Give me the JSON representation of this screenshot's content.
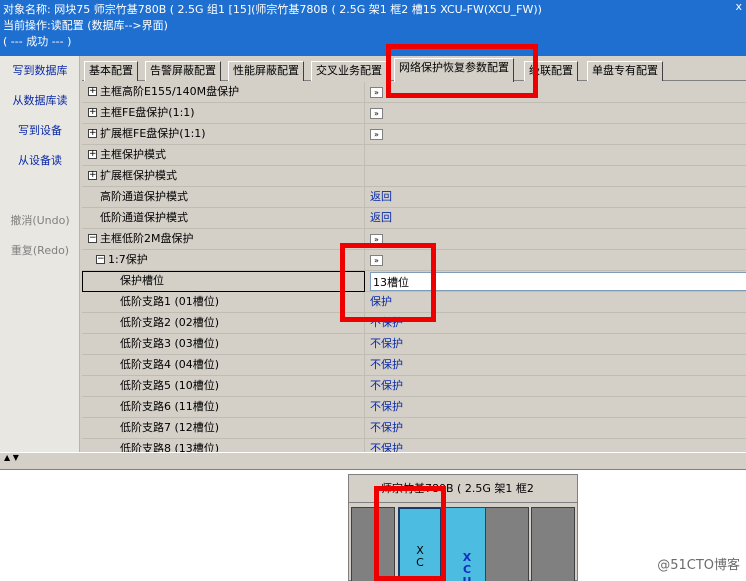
{
  "header": {
    "line1": "对象名称: 网块75 师宗竹基780B ( 2.5G 组1 [15](师宗竹基780B ( 2.5G 架1 框2 槽15 XCU-FW(XCU_FW))",
    "line2": "当前操作:读配置 (数据库-->界面)",
    "line3": "( --- 成功 --- )",
    "close": "x"
  },
  "leftnav": {
    "write_db": "写到数据库",
    "read_db": "从数据库读",
    "write_dev": "写到设备",
    "read_dev": "从设备读",
    "undo": "撤消(Undo)",
    "redo": "重复(Redo)"
  },
  "tabs": [
    "基本配置",
    "告警屏蔽配置",
    "性能屏蔽配置",
    "交叉业务配置",
    "网络保护恢复参数配置",
    "级联配置",
    "单盘专有配置"
  ],
  "rows": [
    {
      "label": "主框高阶E155/140M盘保护",
      "value": "»",
      "pm": "+"
    },
    {
      "label": "主框FE盘保护(1:1)",
      "value": "»",
      "pm": "+"
    },
    {
      "label": "扩展框FE盘保护(1:1)",
      "value": "»",
      "pm": "+"
    },
    {
      "label": "主框保护模式",
      "value": "",
      "pm": "+"
    },
    {
      "label": "扩展框保护模式",
      "value": "",
      "pm": "+"
    },
    {
      "label": "高阶通道保护模式",
      "value": "返回",
      "pm": ""
    },
    {
      "label": "低阶通道保护模式",
      "value": "返回",
      "pm": ""
    },
    {
      "label": "主框低阶2M盘保护",
      "value": "»",
      "pm": "−"
    },
    {
      "label": "1:7保护",
      "value": "»",
      "pm": "−"
    },
    {
      "label": "保护槽位",
      "value": "13槽位",
      "pm": ""
    },
    {
      "label": "低阶支路1 (01槽位)",
      "value": "保护",
      "pm": ""
    },
    {
      "label": "低阶支路2 (02槽位)",
      "value": "不保护",
      "pm": ""
    },
    {
      "label": "低阶支路3 (03槽位)",
      "value": "不保护",
      "pm": ""
    },
    {
      "label": "低阶支路4 (04槽位)",
      "value": "不保护",
      "pm": ""
    },
    {
      "label": "低阶支路5 (10槽位)",
      "value": "不保护",
      "pm": ""
    },
    {
      "label": "低阶支路6 (11槽位)",
      "value": "不保护",
      "pm": ""
    },
    {
      "label": "低阶支路7 (12槽位)",
      "value": "不保护",
      "pm": ""
    },
    {
      "label": "低阶支路8 (13槽位)",
      "value": "不保护",
      "pm": ""
    }
  ],
  "shelf": {
    "title": "师宗竹基780B ( 2.5G 架1 框2",
    "slot1": "X\nC",
    "slot2": "X\nC\nU"
  },
  "watermark": "@51CTO博客",
  "colors": {
    "header": "#1e6fd0",
    "link": "#0a2aa8",
    "callout": "#ee0000",
    "board": "#4cbce0"
  }
}
